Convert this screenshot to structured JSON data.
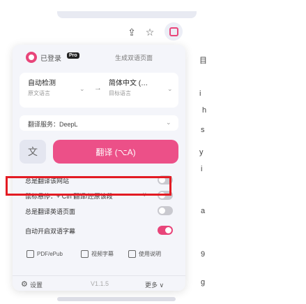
{
  "toolbar": {
    "icons": [
      "share-icon",
      "star-icon",
      "extension-icon"
    ]
  },
  "background_fragments": [
    "目",
    "i",
    "h",
    "s",
    "y",
    "i",
    "a",
    "9",
    "g"
  ],
  "popup": {
    "header": {
      "status": "已登录",
      "badge": "Pro",
      "generate_link": "生成双语页面"
    },
    "languages": {
      "source": {
        "value": "自动检测",
        "sub": "原文语言"
      },
      "target": {
        "value": "简体中文 (…",
        "sub": "目标语言"
      },
      "swap": "→"
    },
    "service": {
      "label": "翻译服务：DeepL"
    },
    "translate_button": "翻译 (⌥A)",
    "settings": [
      {
        "label": "总是翻译该网站",
        "has_chevron": true,
        "on": false
      },
      {
        "label": "鼠标悬停：+ Ctrl 翻译/还原该段",
        "select": "∨",
        "on": false
      },
      {
        "label": "总是翻译英语页面",
        "on": false
      },
      {
        "label": "自动开启双语字幕",
        "on": true
      }
    ],
    "tools": [
      "PDF/ePub",
      "视频字幕",
      "使用说明"
    ],
    "footer": {
      "settings": "设置",
      "version": "V1.1.5",
      "more": "更多 ∨"
    }
  },
  "colors": {
    "accent": "#e8457a",
    "highlight_border": "#e31b23"
  }
}
